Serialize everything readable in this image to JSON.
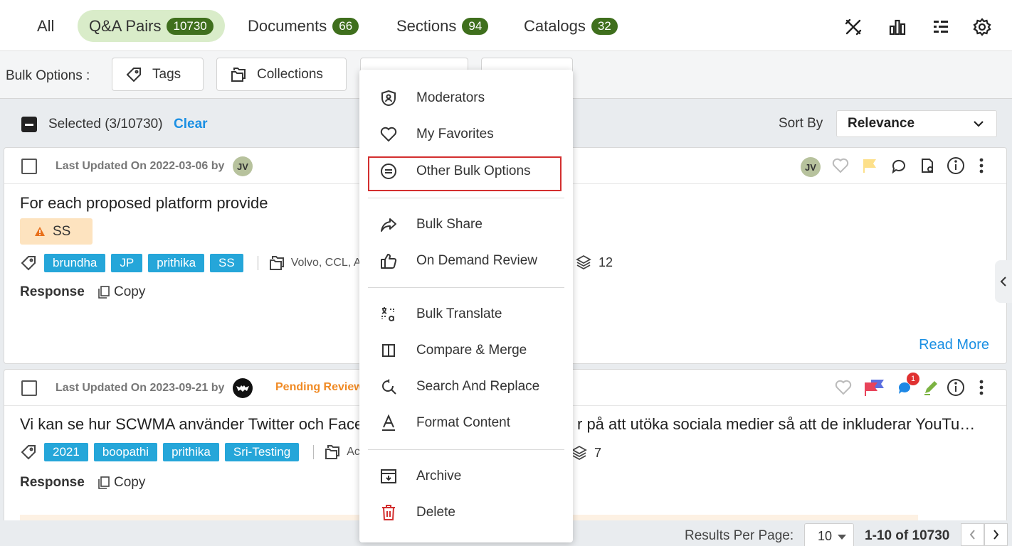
{
  "tabs": [
    {
      "label": "All",
      "count": ""
    },
    {
      "label": "Q&A Pairs",
      "count": "10730"
    },
    {
      "label": "Documents",
      "count": "66"
    },
    {
      "label": "Sections",
      "count": "94"
    },
    {
      "label": "Catalogs",
      "count": "32"
    }
  ],
  "top_icons": [
    "tools-icon",
    "bar-chart-icon",
    "list-view-icon",
    "settings-icon"
  ],
  "bulk": {
    "label": "Bulk Options :",
    "buttons": [
      "Tags",
      "Collections"
    ]
  },
  "selection": {
    "text": "Selected (3/10730)",
    "clear": "Clear",
    "sort_label": "Sort By",
    "sort_value": "Relevance"
  },
  "cards": [
    {
      "updated": "Last Updated On 2022-03-06 by",
      "avatar": "JV",
      "title": "For each proposed platform provide",
      "warning_tag": "SS",
      "tags": [
        "brundha",
        "JP",
        "prithika",
        "SS"
      ],
      "collections": "Volvo, CCL, A",
      "layers": "12",
      "response": "Response",
      "copy": "Copy",
      "read_more": "Read More",
      "owner_avatar": "JV"
    },
    {
      "updated": "Last Updated On 2023-09-21 by",
      "status": "Pending Review",
      "title_left": "Vi kan se hur SCWMA använder Twitter och Face",
      "title_right": "r på att utöka sociala medier så att de inkluderar YouTu…",
      "tags": [
        "2021",
        "boopathi",
        "prithika",
        "Sri-Testing"
      ],
      "collections": "Ac",
      "layers": "7",
      "response": "Response",
      "copy": "Copy",
      "notification_count": "1"
    }
  ],
  "menu": {
    "group1": [
      "Moderators",
      "My Favorites",
      "Other Bulk Options"
    ],
    "group2": [
      "Bulk Share",
      "On Demand Review"
    ],
    "group3": [
      "Bulk Translate",
      "Compare & Merge",
      "Search And Replace",
      "Format Content"
    ],
    "group4": [
      "Archive",
      "Delete"
    ]
  },
  "footer": {
    "rpp_label": "Results Per Page:",
    "rpp_value": "10",
    "range": "1-10 of 10730"
  },
  "colors": {
    "accent": "#1a8fe3",
    "badge": "#3f6f1d",
    "active_tab": "#d9ecc9",
    "tag": "#25a6d9",
    "pending": "#f08a24",
    "highlight": "#d32f2f",
    "delete": "#d32f2f"
  }
}
